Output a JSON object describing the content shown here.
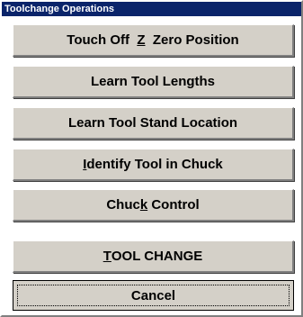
{
  "dialog": {
    "title": "Toolchange Operations"
  },
  "buttons": [
    {
      "pre": "Touch Off  ",
      "mnemonic": "Z",
      "post": "  Zero Position"
    },
    {
      "pre": "Learn Tool Lengths",
      "mnemonic": "",
      "post": ""
    },
    {
      "pre": "Learn Tool Stand Location",
      "mnemonic": "",
      "post": ""
    },
    {
      "pre": "",
      "mnemonic": "I",
      "post": "dentify Tool in Chuck"
    },
    {
      "pre": "Chuc",
      "mnemonic": "k",
      "post": " Control"
    },
    {
      "pre": "",
      "mnemonic": "T",
      "post": "OOL CHANGE"
    },
    {
      "pre": "Cancel",
      "mnemonic": "",
      "post": ""
    }
  ],
  "colors": {
    "titlebar": "#0a246a",
    "button_face": "#d4d0c8"
  }
}
